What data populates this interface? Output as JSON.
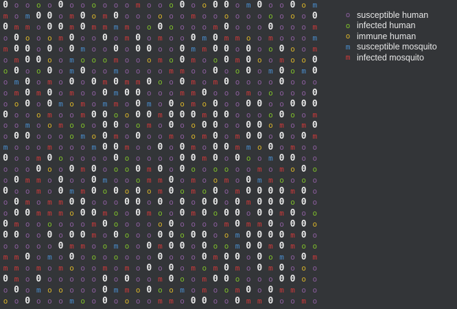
{
  "legend": {
    "items": [
      {
        "symbol": "o",
        "label": "susceptible human",
        "color": "#8c5e9e"
      },
      {
        "symbol": "o",
        "label": "infected human",
        "color": "#7fbf2a"
      },
      {
        "symbol": "o",
        "label": "immune human",
        "color": "#d7b22a"
      },
      {
        "symbol": "m",
        "label": "susceptible mosquito",
        "color": "#4a8fd0"
      },
      {
        "symbol": "m",
        "label": "infected mosquito",
        "color": "#d23a3a"
      }
    ]
  },
  "grid": {
    "empty_cell": {
      "symbol": "0",
      "color": "#e8e8e8"
    },
    "rows": [
      "0oooo0oooooomooo0oo00om0oo0om",
      "mom00om0om0oooooomoooooooooo0",
      "0mmo00m0mmmmoo0oooom0ooo0ooom",
      "o0ooom0oo0om0omoo0m0mmoomooom",
      "m00o0o0moo0o00oo0mm00o0oo0oom",
      "om00oomooomooomo0moo0m0oomoo0",
      "o0oo0om0oomoooommoo0oo0om0om0",
      "om0omo0o0m0mm0oo0mom0oooo0ooo",
      "om0m0omoo0m00ooomm0ooomooooo0",
      "oo0o0momommo0mo0omo0oo00oo000",
      "0ooomoom00oo00m000m00oooo0oom",
      "oomoomooo00oomo0oo00oo00omom0",
      "o00oooomo0mo0oomoom0om00o0o0m",
      "mooomooom00moo0o0mo00mmo0omoo",
      "0oom0ooooo0ooooo00m0o0oom00oo",
      "ooo0oo0m0ooo0m0o0oooooomomo0o",
      "o0mmo0oo0mooomm0omoomo0mmoooo",
      "0oomo0mm0o0o0om0omo0om0000m0o",
      "o0momm00ooo00o0o0o00o0m000o0o",
      "o00mmmo00moo0moo0m0o00o00m0oo",
      "0moooooom0ooooo0oooom0mm0o00o",
      "00oo0o00mo0ooo00o00oom0000m0o",
      "ooooo0mmoomoo0m00o0oom00m0moo",
      "mm0omo0ooooooo0ooo0m00o0omo0m",
      "mmomomooomomo0o0omom0mo0m0ooo",
      "0mo0ooooo0o0oom0oom00oooo00oo",
      "o0omooooo0mmo0oomomoom0o0mmoo",
      "oo0ooomoo0oooommo00oo0mm0oomo"
    ]
  }
}
